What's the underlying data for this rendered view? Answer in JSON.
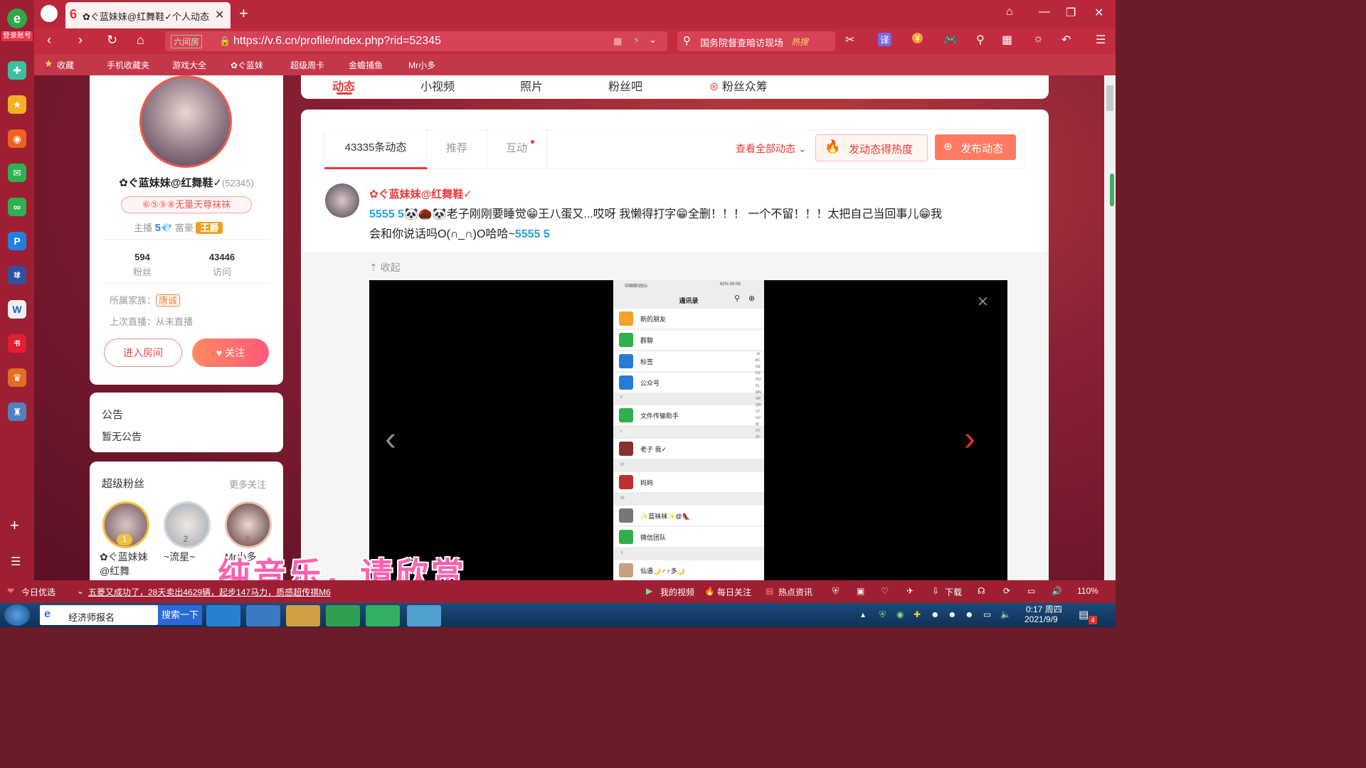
{
  "browser": {
    "login_label": "登录账号",
    "tab_title": "✿ぐ蓝妹妹@红舞鞋✓个人动态",
    "url": "https://v.6.cn/profile/index.php?rid=52345",
    "url_badge": "六间房",
    "search_text": "国务院督查暗访现场",
    "search_hot": "热搜",
    "bookmarks": [
      "收藏",
      "手机收藏夹",
      "游戏大全",
      "✿ぐ蓝妹",
      "超级周卡",
      "金蟾捕鱼",
      "Mr小多"
    ]
  },
  "profile": {
    "name": "✿ぐ蓝妹妹@红舞鞋✓",
    "rid": "(52345)",
    "badge": "⑥⑤⑨⑧无量天尊袜袜",
    "anchor_label": "主播",
    "anchor_level": "5",
    "rich_label": "富豪",
    "rich_title": "王爵",
    "fans_count": "594",
    "fans_label": "粉丝",
    "visits_count": "43446",
    "visits_label": "访问",
    "family_label": "所属家族：",
    "family_value": "唐诚",
    "last_live": "上次直播：从未直播",
    "enter_room": "进入房间",
    "follow": "关注"
  },
  "notice": {
    "title": "公告",
    "content": "暂无公告"
  },
  "super_fans": {
    "title": "超级粉丝",
    "more": "更多关注",
    "fans": [
      {
        "rank": "1",
        "name": "✿ぐ蓝妹妹@红舞"
      },
      {
        "rank": "2",
        "name": "~流星~"
      },
      {
        "rank": "3",
        "name": "Mr小多"
      }
    ]
  },
  "top_tabs": [
    "动态",
    "小视频",
    "照片",
    "粉丝吧",
    "粉丝众筹"
  ],
  "feed": {
    "tabs": [
      "43335条动态",
      "推荐",
      "互动"
    ],
    "view_all": "查看全部动态",
    "hot_button": "发动态得热度",
    "publish_button": "发布动态",
    "post_author": "✿ぐ蓝妹妹@红舞鞋✓",
    "post_text_1": "老子刚刚要睡觉",
    "post_text_2": "王八蛋又...哎呀 我懒得打字",
    "post_text_3": "全删！！！ 一个不留！！！太把自己当回事儿",
    "post_text_4": "我",
    "post_text_5": "会和你说话吗O(∩_∩)O哈哈~",
    "collapse": "收起"
  },
  "phone": {
    "status_left": "中国移动5G",
    "status_right": "82% 00:08",
    "title": "通讯录",
    "rows": [
      {
        "label": "新的朋友",
        "color": "#f5a02a"
      },
      {
        "label": "群聊",
        "color": "#2fb04a"
      },
      {
        "label": "标签",
        "color": "#2a7ad5"
      },
      {
        "label": "公众号",
        "color": "#2a7ad5"
      },
      {
        "label": "文件传输助手",
        "color": "#2fb04a"
      },
      {
        "label": "老子 我✓",
        "color": "#8a3030"
      },
      {
        "label": "妈妈",
        "color": "#c03030"
      },
      {
        "label": "✨蓝袜袜✨@👠",
        "color": "#777"
      },
      {
        "label": "微信团队",
        "color": "#2fb04a"
      },
      {
        "label": "仙遇🌙♂♂多🌙",
        "color": "#c9a080"
      }
    ],
    "sections": [
      "F",
      "L",
      "M",
      "W",
      "X"
    ]
  },
  "subtitle": "纯音乐，请欣赏",
  "statusbar": {
    "today": "今日优选",
    "news": "五菱又成功了，28天卖出4629辆，起步147马力，质感超传祺M6",
    "my_video": "我的视频",
    "daily": "每日关注",
    "hot_news": "热点资讯",
    "download": "下载",
    "zoom": "110%"
  },
  "taskbar": {
    "item": "经济师报名",
    "search": "搜索一下",
    "time": "0:17 周四",
    "date": "2021/9/9",
    "notify": "4"
  }
}
